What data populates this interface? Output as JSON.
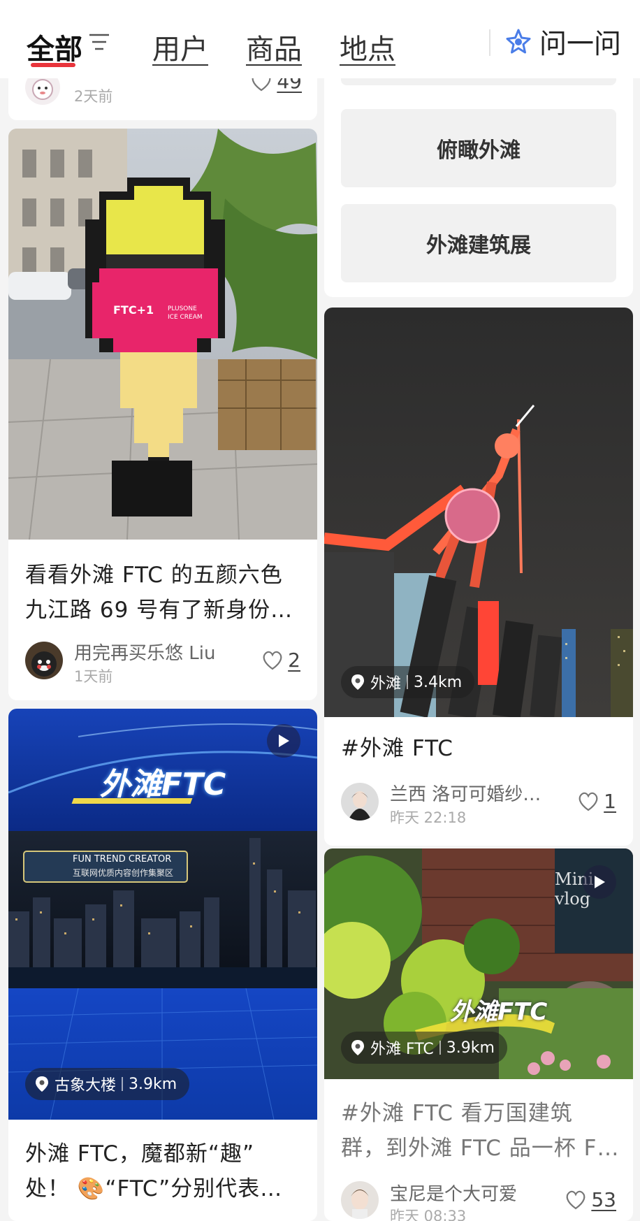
{
  "header": {
    "tabs": [
      {
        "label": "全部",
        "active": true
      },
      {
        "label": "用户"
      },
      {
        "label": "商品"
      },
      {
        "label": "地点"
      }
    ],
    "ask_label": "问一问"
  },
  "left": {
    "card0": {
      "time": "2天前",
      "likes": "49"
    },
    "card1": {
      "title_line1": "看看外滩 FTC 的五颜六色",
      "title_line2": "九江路 69 号有了新身份…",
      "user": "用完再买乐悠 Liu",
      "time": "1天前",
      "likes": "2"
    },
    "card2": {
      "image_text_logo": "外滩FTC",
      "image_text_banner_en": "FUN TREND CREATOR",
      "image_text_banner_cn": "互联网优质内容创作集聚区",
      "location": "古象大楼",
      "distance": "3.9km",
      "title_line1": "外滩 FTC，魔都新“趣”",
      "title_line2": "处！ 🎨“FTC”分别代表…"
    }
  },
  "right": {
    "chips": [
      "俯瞰外滩",
      "外滩建筑展"
    ],
    "card1": {
      "location": "外滩",
      "distance": "3.4km",
      "title": "#外滩 FTC",
      "user": "兰西 洛可可婚纱…",
      "time": "昨天 22:18",
      "likes": "1"
    },
    "card2": {
      "image_text_corner": "Mini vlog",
      "image_text_logo": "外滩FTC",
      "location": "外滩 FTC",
      "distance": "3.9km",
      "title_line1": "#外滩 FTC 看万国建筑",
      "title_line2": "群，到外滩 FTC 品一杯 F…",
      "user": "宝尼是个大可爱",
      "time": "昨天 08:33",
      "likes": "53"
    }
  },
  "colors": {
    "accent": "#e8343b",
    "ask_icon": "#4a7de8"
  }
}
